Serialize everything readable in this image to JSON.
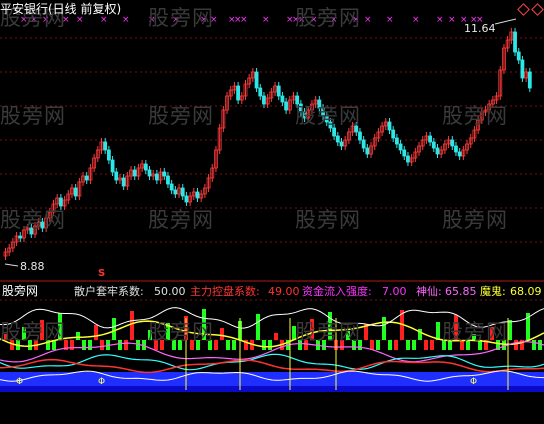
{
  "main_chart": {
    "title": "平安银行(日线 前复权)",
    "high_price_label": "11.64",
    "low_price_label": "8.88",
    "buy_marker": "S",
    "colors": {
      "up": "#ff3b3b",
      "down": "#2ee6e6",
      "title": "#ffffff",
      "marker": "#ff33ff"
    }
  },
  "indicator_bar": {
    "panel_label": "股旁网",
    "items": [
      {
        "label": "散户套牢系数:",
        "value": "50.00",
        "color": "#e0e0e0"
      },
      {
        "label": "主力控盘系数:",
        "value": "49.00",
        "color": "#ff3333"
      },
      {
        "label": "资金流入强度:",
        "value": "7.00",
        "color": "#ff33ff"
      },
      {
        "label": "神仙:",
        "value": "65.85",
        "color": "#ff66ff"
      },
      {
        "label": "魔鬼:",
        "value": "68.09",
        "color": "#ffff33"
      }
    ]
  },
  "watermark_text": "股旁网"
}
